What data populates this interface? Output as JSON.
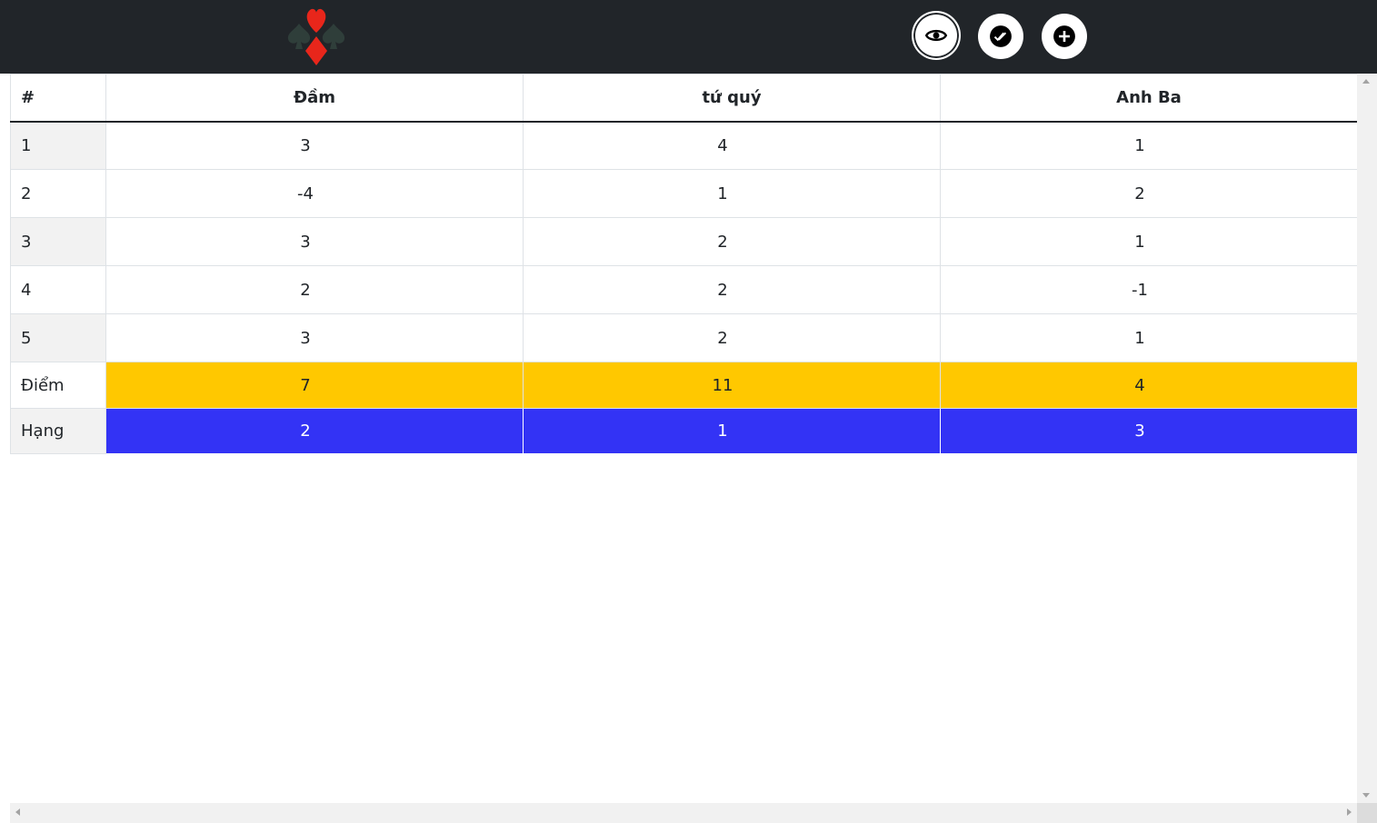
{
  "navbar": {
    "logo_icon": "card-suits-logo-icon",
    "buttons": [
      {
        "icon": "eye-icon",
        "state": "active"
      },
      {
        "icon": "check-double-icon"
      },
      {
        "icon": "plus-icon"
      }
    ]
  },
  "table": {
    "hash_header": "#",
    "players": [
      "Đầm",
      "tứ quý",
      "Anh Ba"
    ],
    "rounds": [
      {
        "label": "1",
        "scores": [
          "3",
          "4",
          "1"
        ]
      },
      {
        "label": "2",
        "scores": [
          "-4",
          "1",
          "2"
        ]
      },
      {
        "label": "3",
        "scores": [
          "3",
          "2",
          "1"
        ]
      },
      {
        "label": "4",
        "scores": [
          "2",
          "2",
          "-1"
        ]
      },
      {
        "label": "5",
        "scores": [
          "3",
          "2",
          "1"
        ]
      }
    ],
    "total": {
      "label": "Điểm",
      "values": [
        "7",
        "11",
        "4"
      ]
    },
    "rank": {
      "label": "Hạng",
      "values": [
        "2",
        "1",
        "3"
      ]
    }
  },
  "colors": {
    "navbar_bg": "#212529",
    "total_row_bg": "#ffc800",
    "rank_row_bg": "#3333f5",
    "logo_red": "#e8261b",
    "logo_dark": "#2f3e3a"
  }
}
